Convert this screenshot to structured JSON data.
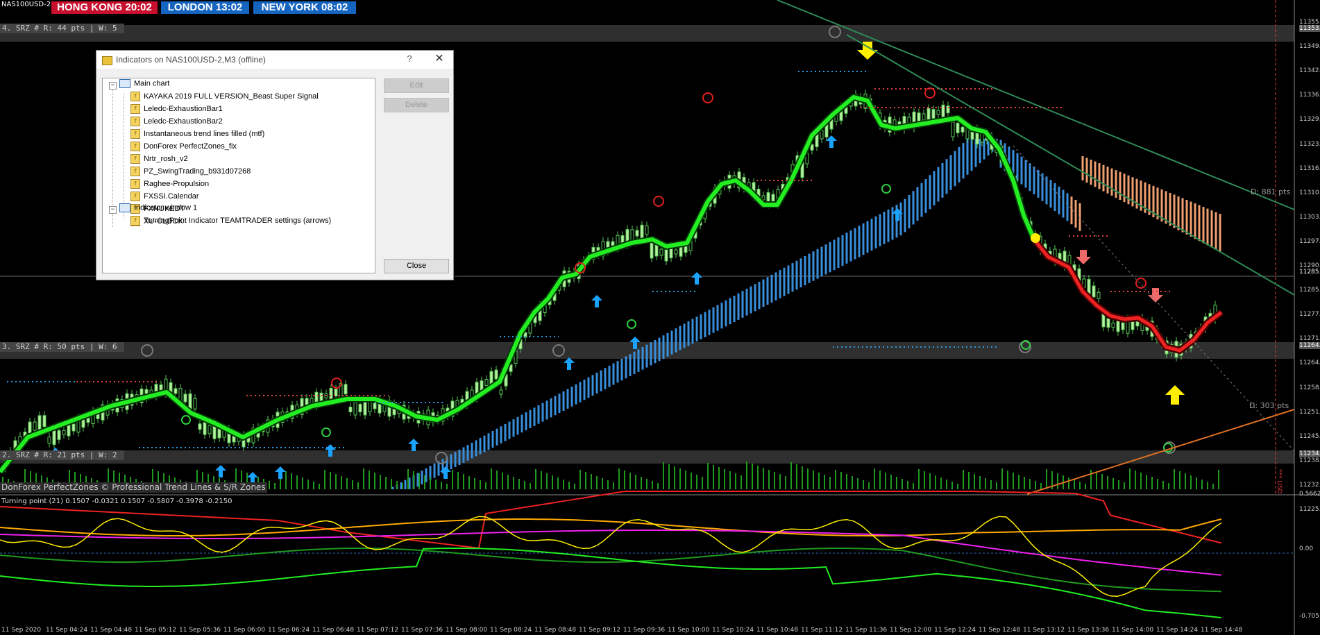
{
  "window": {
    "symbol_tab": "NAS100USD-2"
  },
  "clocks": {
    "hong_kong": "HONG KONG 20:02",
    "london": "LONDON  13:02",
    "new_york": "NEW YORK  08:02"
  },
  "srz_labels": [
    "4. SRZ # R: 44 pts | W: 5",
    "3. SRZ # R: 50 pts | W: 6",
    "2. SRZ # R: 21 pts | W: 2"
  ],
  "watermark": "DonForex PerfectZones © Professional Trend Lines & S/R Zones",
  "subwindow_title": "Turning point (21) 0.1507 -0.0321 0.1507 -0.5807 -0.3978 -0.2150",
  "distance_labels": {
    "upper": "D: 881 pts",
    "lower": "D: 303 pts"
  },
  "usd_marker": "*** USD",
  "price_axis": [
    "11355.5",
    "11349.0",
    "11342.5",
    "11336.0",
    "11329.5",
    "11323.0",
    "11316.5",
    "11310.0",
    "11303.5",
    "11297.0",
    "11290.5",
    "11285.0",
    "11277.5",
    "11271.0",
    "11264.5",
    "11258.0",
    "11251.5",
    "11245.0",
    "11238.5",
    "11232.0",
    "11225.5"
  ],
  "price_highlights": {
    "srz4": "11353.4",
    "current": "11285.0",
    "srz3": "11264.5",
    "srz2": "11234.0"
  },
  "oscillator_axis": [
    "0.5662",
    "0.00",
    "-0.705"
  ],
  "time_axis": [
    "11 Sep 2020",
    "11 Sep 04:24",
    "11 Sep 04:48",
    "11 Sep 05:12",
    "11 Sep 05:36",
    "11 Sep 06:00",
    "11 Sep 06:24",
    "11 Sep 06:48",
    "11 Sep 07:12",
    "11 Sep 07:36",
    "11 Sep 08:00",
    "11 Sep 08:24",
    "11 Sep 08:48",
    "11 Sep 09:12",
    "11 Sep 09:36",
    "11 Sep 10:00",
    "11 Sep 10:24",
    "11 Sep 10:48",
    "11 Sep 11:12",
    "11 Sep 11:36",
    "11 Sep 12:00",
    "11 Sep 12:24",
    "11 Sep 12:48",
    "11 Sep 13:12",
    "11 Sep 13:36",
    "11 Sep 14:00",
    "11 Sep 14:24",
    "11 Sep 14:48"
  ],
  "dialog": {
    "title": "Indicators on NAS100USD-2,M3 (offline)",
    "help": "?",
    "close_x": "✕",
    "tree": {
      "main_chart": "Main chart",
      "main_items": [
        "KAYAKA 2019 FULL VERSION_Beast Super Signal",
        "Leledc-ExhaustionBar1",
        "Leledc-ExhaustionBar2",
        "Instantaneous trend lines filled (mtf)",
        "DonForex PerfectZones_fix",
        "Nrtr_rosh_v2",
        "PZ_SwingTrading_b931d07268",
        "Raghee-Propulsion",
        "FXSSI.Calendar",
        "FXNUKEDT",
        "XU-CLOCK"
      ],
      "window1": "Indicator window 1",
      "window1_items": [
        "TurningPoint Indicator TEAMTRADER settings (arrows)"
      ]
    },
    "buttons": {
      "edit": "Edit",
      "delete": "Delete",
      "close": "Close"
    }
  },
  "colors": {
    "trend_green": "#22ee22",
    "trend_red": "#ee2222",
    "cloud_blue": "#3a8fdc",
    "cloud_orange": "#f0a070",
    "zone_gray": "#555555",
    "trendline_green": "#2e8b57",
    "trendline_orange": "#e07020"
  }
}
